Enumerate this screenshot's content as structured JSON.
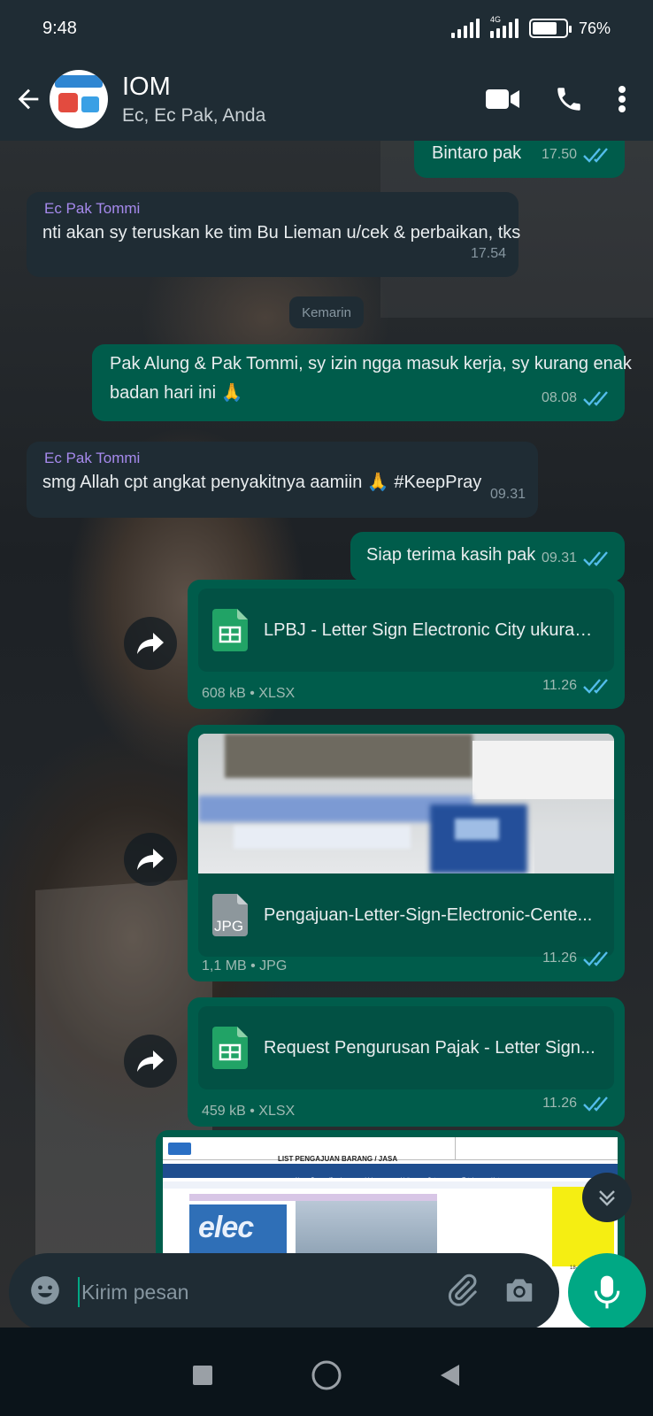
{
  "status_bar": {
    "time": "9:48",
    "network": "4G",
    "battery": "76%",
    "battery_level": 0.76
  },
  "header": {
    "group_name": "IOM",
    "members": "Ec, Ec Pak, Anda"
  },
  "date_chip": "Kemarin",
  "messages": [
    {
      "text": "Bintaro pak",
      "time": "17.50"
    },
    {
      "sender": "Ec Pak Tommi",
      "text": "nti akan sy teruskan ke tim Bu Lieman u/cek & perbaikan, tks",
      "time": "17.54"
    },
    {
      "text_line1": "Pak Alung & Pak Tommi, sy izin ngga masuk kerja, sy kurang enak",
      "text_line2": "badan hari ini 🙏",
      "time": "08.08"
    },
    {
      "sender": "Ec Pak Tommi",
      "text": "smg Allah cpt angkat penyakitnya aamiin 🙏 #KeepPray",
      "time": "09.31"
    },
    {
      "text": "Siap terima kasih pak",
      "time": "09.31"
    }
  ],
  "documents": [
    {
      "name": "LPBJ  - Letter Sign Electronic City ukuran...",
      "info": "608 kB • XLSX",
      "time": "11.26",
      "icon": "sheets-icon"
    },
    {
      "name": "Pengajuan-Letter-Sign-Electronic-Cente...",
      "info": "1,1 MB • JPG",
      "time": "11.26",
      "icon": "jpg-file-icon",
      "icon_label": "JPG"
    },
    {
      "name": "Request Pengurusan Pajak  - Letter Sign...",
      "info": "459 kB • XLSX",
      "time": "11.26",
      "icon": "sheets-icon"
    }
  ],
  "sheet_preview": {
    "title": "LIST PENGAJUAN BARANG / JASA",
    "header_cols": [
      "Nama Barang/Service",
      "Volume",
      "Unit",
      "Satuan",
      "Total",
      "Keteran"
    ],
    "date": "18-Apr-22"
  },
  "input": {
    "placeholder": "Kirim pesan"
  },
  "colors": {
    "outgoing": "#005c4b",
    "incoming": "#1f2c34",
    "accent": "#00a884",
    "header": "#1f2c34"
  }
}
